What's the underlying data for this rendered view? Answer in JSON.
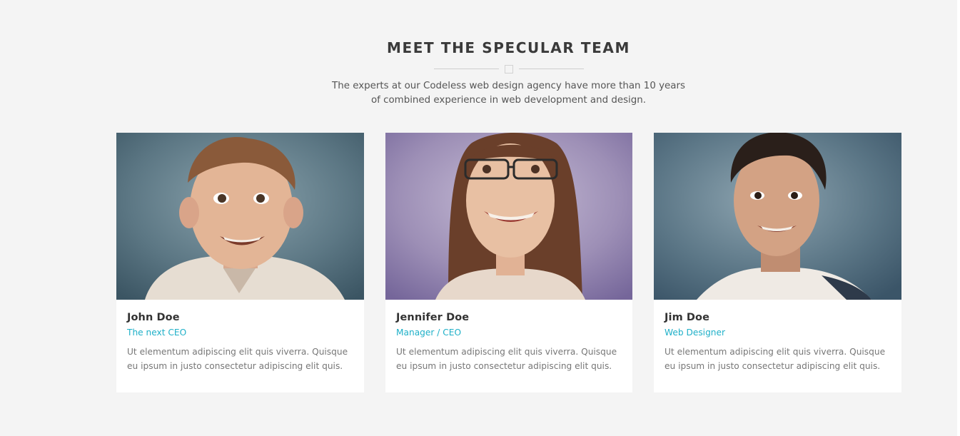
{
  "section": {
    "title": "MEET THE SPECULAR TEAM",
    "subtitle_line1": "The experts at our Codeless web design agency have more than 10 years",
    "subtitle_line2": "of combined experience in web development and design."
  },
  "team": [
    {
      "name": "John Doe",
      "role": "The next CEO",
      "bio": "Ut elementum adipiscing elit quis viverra. Quisque eu ipsum in justo consectetur adipiscing elit quis."
    },
    {
      "name": "Jennifer Doe",
      "role": "Manager / CEO",
      "bio": "Ut elementum adipiscing elit quis viverra. Quisque eu ipsum in justo consectetur adipiscing elit quis."
    },
    {
      "name": "Jim Doe",
      "role": "Web Designer",
      "bio": "Ut elementum adipiscing elit quis viverra. Quisque eu ipsum in justo consectetur adipiscing elit quis."
    }
  ],
  "colors": {
    "background": "#f4f4f4",
    "card": "#ffffff",
    "accent": "#1fb0c8",
    "heading": "#3a3a3a",
    "body_text": "#777777"
  }
}
